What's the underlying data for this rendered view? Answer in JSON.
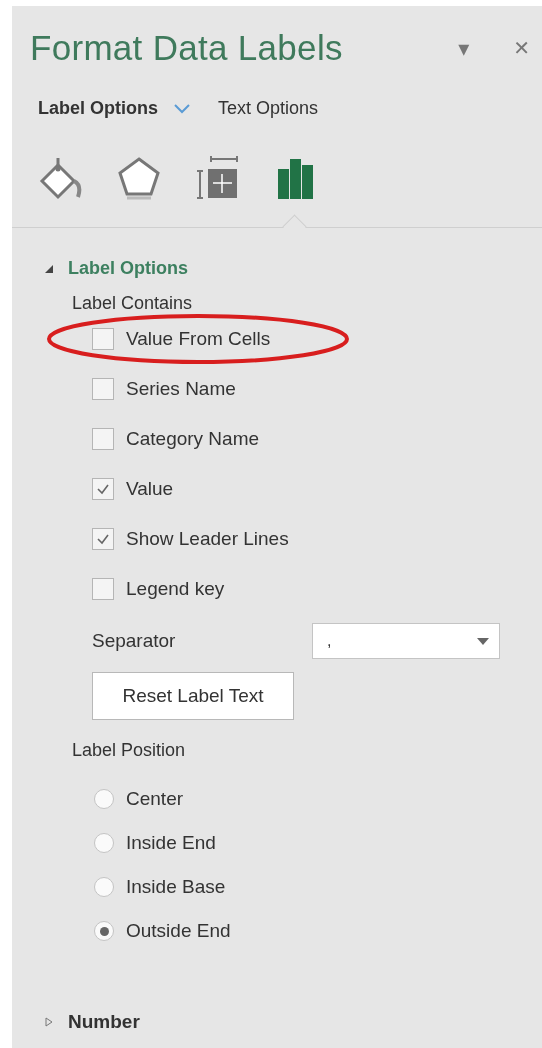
{
  "pane": {
    "title": "Format Data Labels",
    "menu_glyph": "▾",
    "close_glyph": "✕"
  },
  "tabs": [
    {
      "label": "Label Options",
      "selected": true
    },
    {
      "label": "Text Options",
      "selected": false
    }
  ],
  "icon_tabs": [
    {
      "kind": "fill",
      "selected": false
    },
    {
      "kind": "effects",
      "selected": false
    },
    {
      "kind": "size",
      "selected": false
    },
    {
      "kind": "options",
      "selected": true
    }
  ],
  "section": {
    "title": "Label Options",
    "expanded": true,
    "contains_label": "Label Contains",
    "checkboxes": [
      {
        "label": "Value From Cells",
        "checked": false,
        "circled": true
      },
      {
        "label": "Series Name",
        "checked": false,
        "circled": false
      },
      {
        "label": "Category Name",
        "checked": false,
        "circled": false
      },
      {
        "label": "Value",
        "checked": true,
        "circled": false
      },
      {
        "label": "Show Leader Lines",
        "checked": true,
        "circled": false
      },
      {
        "label": "Legend key",
        "checked": false,
        "circled": false
      }
    ],
    "separator": {
      "label": "Separator",
      "value": ","
    },
    "reset_button": {
      "label": "Reset Label Text"
    },
    "position_label": "Label Position",
    "positions": [
      {
        "label": "Center",
        "selected": false
      },
      {
        "label": "Inside End",
        "selected": false
      },
      {
        "label": "Inside Base",
        "selected": false
      },
      {
        "label": "Outside End",
        "selected": true
      }
    ]
  },
  "collapsed_section": {
    "title": "Number",
    "expanded": false
  }
}
